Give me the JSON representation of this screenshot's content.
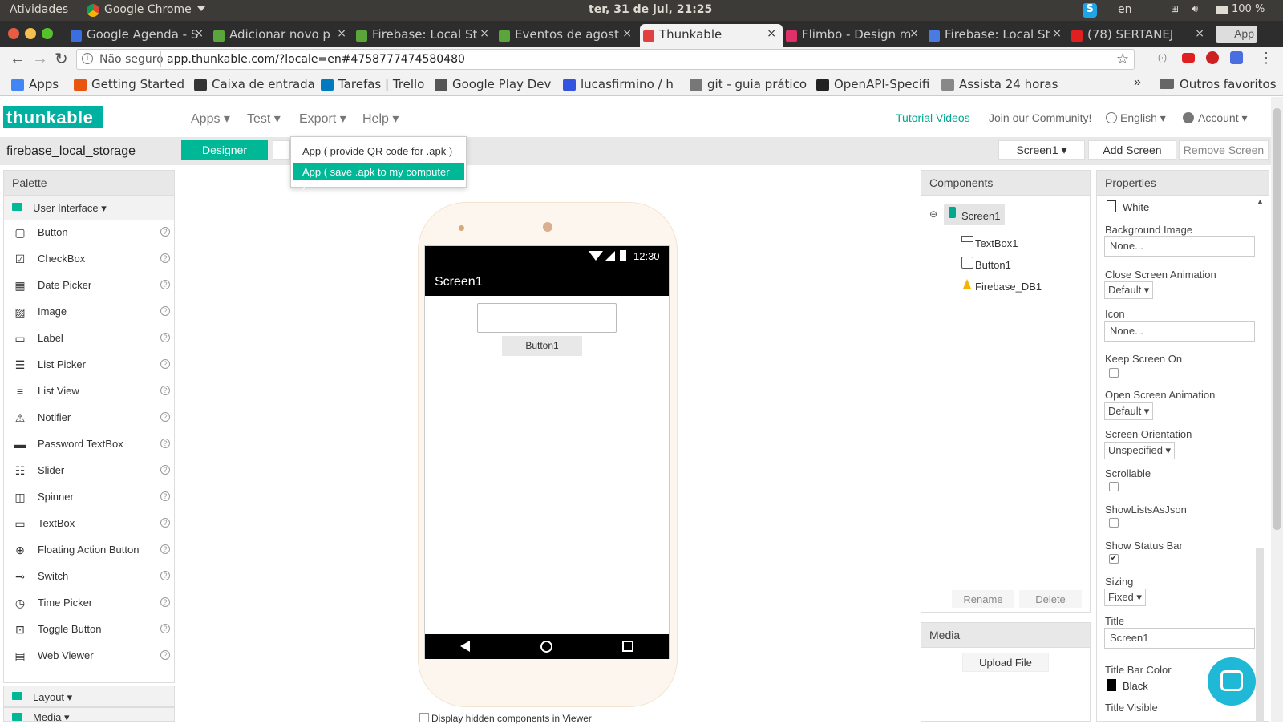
{
  "os_bar": {
    "activities": "Atividades",
    "app_name": "Google Chrome",
    "datetime": "ter, 31 de jul, 21:25",
    "lang": "en",
    "battery": "100 %"
  },
  "browser": {
    "tabs": [
      {
        "label": "Google Agenda - S",
        "icon_color": "#3b6ee0"
      },
      {
        "label": "Adicionar novo p",
        "icon_color": "#5aa63a"
      },
      {
        "label": "Firebase: Local St",
        "icon_color": "#5aa63a"
      },
      {
        "label": "Eventos de agost",
        "icon_color": "#5aa63a"
      },
      {
        "label": "Thunkable",
        "icon_color": "#e04040"
      },
      {
        "label": "Flimbo - Design m",
        "icon_color": "#e0306a"
      },
      {
        "label": "Firebase: Local St",
        "icon_color": "#4a7be0"
      },
      {
        "label": "(78) SERTANEJ",
        "icon_color": "#e02020"
      }
    ],
    "apps_label": "App",
    "url_insecure": "Não seguro",
    "url": "app.thunkable.com/?locale=en#4758777474580480",
    "bookmarks": [
      {
        "label": "Apps",
        "icon_color": "#4285f4"
      },
      {
        "label": "Getting Started",
        "icon_color": "#e8550e"
      },
      {
        "label": "Caixa de entrada",
        "icon_color": "#333333"
      },
      {
        "label": "Tarefas | Trello",
        "icon_color": "#0079bf"
      },
      {
        "label": "Google Play Dev",
        "icon_color": "#555555"
      },
      {
        "label": "lucasfirmino / h",
        "icon_color": "#3355dd"
      },
      {
        "label": "git - guia prático",
        "icon_color": "#777777"
      },
      {
        "label": "OpenAPI-Specifi",
        "icon_color": "#222222"
      },
      {
        "label": "Assista 24 horas",
        "icon_color": "#888888"
      }
    ],
    "more": "»",
    "other_favorites": "Outros favoritos"
  },
  "app": {
    "logo": "thunkable",
    "menus": [
      "Apps ▾",
      "Test ▾",
      "Export ▾",
      "Help ▾"
    ],
    "tutorial": "Tutorial Videos",
    "community": "Join our Community!",
    "language": "English ▾",
    "account": "Account ▾",
    "project_name": "firebase_local_storage",
    "designer_btn": "Designer",
    "screen_select": "Screen1 ▾",
    "add_screen": "Add Screen",
    "remove_screen": "Remove Screen",
    "export_menu": [
      "App ( provide QR code for .apk )",
      "App ( save .apk to my computer )"
    ],
    "accent": "#00b896"
  },
  "palette": {
    "title": "Palette",
    "category": "User Interface ▾",
    "items": [
      {
        "label": "Button",
        "icon": "button-icon"
      },
      {
        "label": "CheckBox",
        "icon": "checkbox-icon"
      },
      {
        "label": "Date Picker",
        "icon": "calendar-icon"
      },
      {
        "label": "Image",
        "icon": "image-icon"
      },
      {
        "label": "Label",
        "icon": "label-icon"
      },
      {
        "label": "List Picker",
        "icon": "list-picker-icon"
      },
      {
        "label": "List View",
        "icon": "list-view-icon"
      },
      {
        "label": "Notifier",
        "icon": "warning-icon"
      },
      {
        "label": "Password TextBox",
        "icon": "password-icon"
      },
      {
        "label": "Slider",
        "icon": "slider-icon"
      },
      {
        "label": "Spinner",
        "icon": "spinner-icon"
      },
      {
        "label": "TextBox",
        "icon": "textbox-icon"
      },
      {
        "label": "Floating Action Button",
        "icon": "plus-circle-icon"
      },
      {
        "label": "Switch",
        "icon": "switch-icon"
      },
      {
        "label": "Time Picker",
        "icon": "clock-icon"
      },
      {
        "label": "Toggle Button",
        "icon": "toggle-icon"
      },
      {
        "label": "Web Viewer",
        "icon": "browser-icon"
      }
    ],
    "layout": "Layout ▾",
    "media": "Media ▾",
    "help_glyph": "?"
  },
  "viewer": {
    "status_time": "12:30",
    "screen_title": "Screen1",
    "button_label": "Button1",
    "hidden_checkbox_label": "Display hidden components in Viewer"
  },
  "components": {
    "title": "Components",
    "items": [
      "Screen1",
      "TextBox1",
      "Button1",
      "Firebase_DB1"
    ],
    "rename": "Rename",
    "delete": "Delete",
    "collapse": "⊖"
  },
  "media": {
    "title": "Media",
    "upload": "Upload File"
  },
  "properties": {
    "title": "Properties",
    "bg_color_value": "White",
    "background_image_label": "Background Image",
    "background_image_value": "None...",
    "close_anim_label": "Close Screen Animation",
    "close_anim_value": "Default ▾",
    "icon_label": "Icon",
    "icon_value": "None...",
    "keep_on_label": "Keep Screen On",
    "open_anim_label": "Open Screen Animation",
    "open_anim_value": "Default ▾",
    "orientation_label": "Screen Orientation",
    "orientation_value": "Unspecified ▾",
    "scrollable_label": "Scrollable",
    "showlists_label": "ShowListsAsJson",
    "statusbar_label": "Show Status Bar",
    "statusbar_check": "✔",
    "sizing_label": "Sizing",
    "sizing_value": "Fixed ▾",
    "title_label": "Title",
    "title_value": "Screen1",
    "titlebar_color_label": "Title Bar Color",
    "titlebar_color_value": "Black",
    "title_visible_label": "Title Visible"
  }
}
